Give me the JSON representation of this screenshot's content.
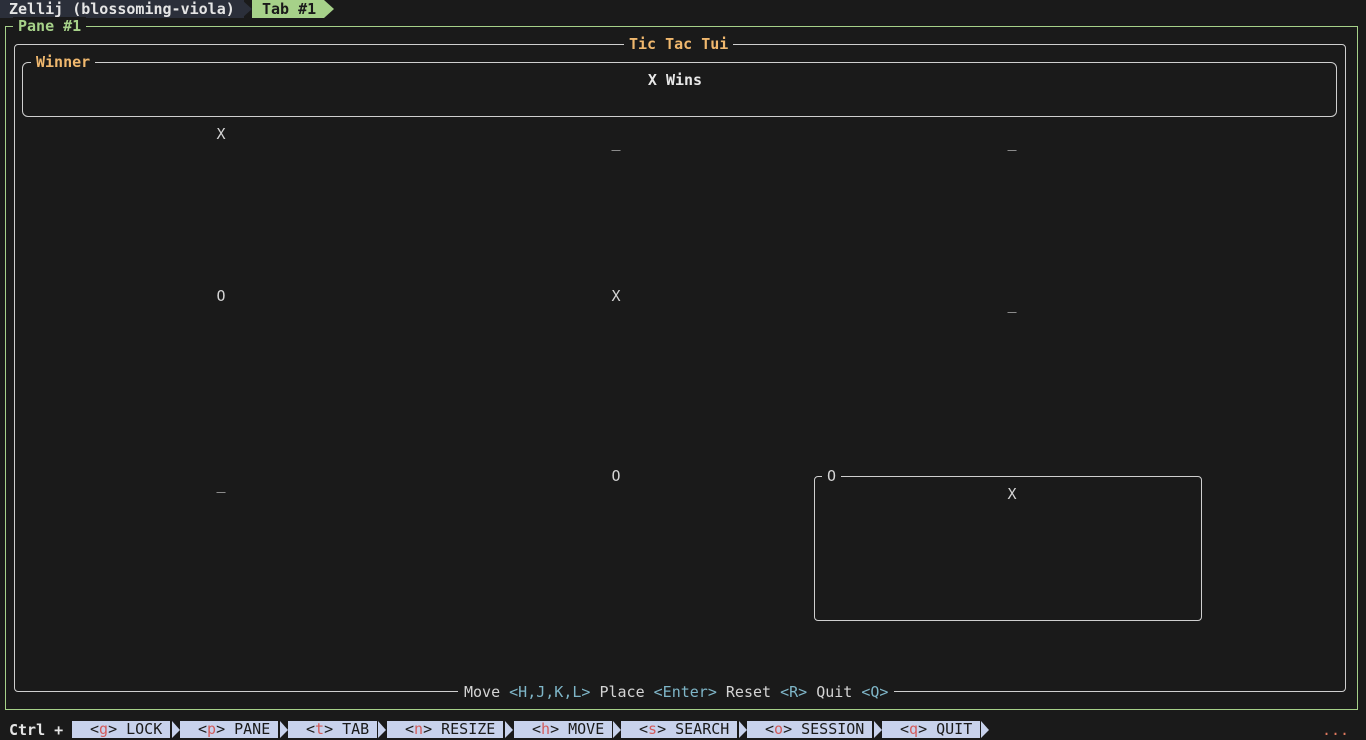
{
  "topbar": {
    "session_label": "Zellij (blossoming-viola)",
    "tab_label": "Tab #1"
  },
  "pane": {
    "title": "Pane #1"
  },
  "app": {
    "title": "Tic Tac Tui",
    "winner_box_title": "Winner",
    "winner_text": "X Wins",
    "board": [
      [
        "X",
        "_",
        "_"
      ],
      [
        "O",
        "X",
        "_"
      ],
      [
        "_",
        "O",
        "X"
      ]
    ],
    "selected_cell_title": "O",
    "help": {
      "move_label": "Move",
      "move_keys": "<H,J,K,L>",
      "place_label": "Place",
      "place_key": "<Enter>",
      "reset_label": "Reset",
      "reset_key": "<R>",
      "quit_label": "Quit",
      "quit_key": "<Q>"
    }
  },
  "statusbar": {
    "modifier": "Ctrl +",
    "items": [
      {
        "key": "g",
        "label": "LOCK"
      },
      {
        "key": "p",
        "label": "PANE"
      },
      {
        "key": "t",
        "label": "TAB"
      },
      {
        "key": "n",
        "label": "RESIZE"
      },
      {
        "key": "h",
        "label": "MOVE"
      },
      {
        "key": "s",
        "label": "SEARCH"
      },
      {
        "key": "o",
        "label": "SESSION"
      },
      {
        "key": "q",
        "label": "QUIT"
      }
    ],
    "overflow": "..."
  },
  "colors": {
    "background": "#1a1a1a",
    "pane_frame": "#a6d189",
    "title_accent": "#f0b86e",
    "key_accent": "#7fb6c8",
    "statusbar_segment": "#c8d2ec",
    "statusbar_key": "#d35c5c"
  }
}
